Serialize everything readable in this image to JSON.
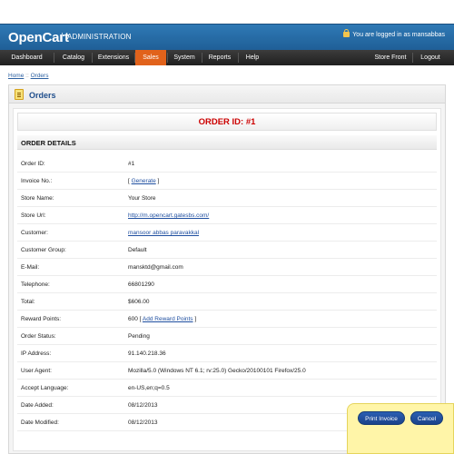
{
  "brand": {
    "logo": "OpenCart",
    "admin": "ADMINISTRATION",
    "logged_in": "You are logged in as mansabbas",
    "lock_icon": "lock-icon"
  },
  "menu": {
    "items": [
      "Dashboard",
      "Catalog",
      "Extensions",
      "Sales",
      "System",
      "Reports",
      "Help",
      "Store Front",
      "Logout"
    ],
    "active": "Sales"
  },
  "breadcrumb": {
    "home": "Home",
    "separator": "::",
    "orders": "Orders"
  },
  "panel": {
    "title": "Orders",
    "icon": "orders-icon"
  },
  "order": {
    "title": "ORDER ID: #1",
    "details_heading": "ORDER DETAILS",
    "rows": [
      {
        "label": "Order ID:",
        "value": "#1"
      },
      {
        "label": "Invoice No.:",
        "value_prefix": "[",
        "link": "Generate",
        "value_suffix": "]"
      },
      {
        "label": "Store Name:",
        "value": "Your Store"
      },
      {
        "label": "Store Url:",
        "link": "http://m.opencart.gatesbs.com/"
      },
      {
        "label": "Customer:",
        "link": "mansoor abbas paravakkal"
      },
      {
        "label": "Customer Group:",
        "value": "Default"
      },
      {
        "label": "E-Mail:",
        "value": "mansktd@gmail.com"
      },
      {
        "label": "Telephone:",
        "value": "66801290"
      },
      {
        "label": "Total:",
        "value": "$606.00"
      },
      {
        "label": "Reward Points:",
        "value_prefix": "600 [",
        "link": "Add Reward Points",
        "value_suffix": "]"
      },
      {
        "label": "Order Status:",
        "value": "Pending"
      },
      {
        "label": "IP Address:",
        "value": "91.140.218.36"
      },
      {
        "label": "User Agent:",
        "value": "Mozilla/5.0 (Windows NT 6.1; rv:25.0) Gecko/20100101 Firefox/25.0"
      },
      {
        "label": "Accept Language:",
        "value": "en-US,en;q=0.5"
      },
      {
        "label": "Date Added:",
        "value": "08/12/2013"
      },
      {
        "label": "Date Modified:",
        "value": "08/12/2013"
      }
    ]
  },
  "buttons": {
    "print": "Print Invoice",
    "cancel": "Cancel"
  },
  "colors": {
    "brand_blue": "#2f79b5",
    "menu_active": "#e1621b",
    "order_id_red": "#cc0000",
    "button_blue": "#1b428a",
    "button_bar": "#fff5a8"
  }
}
